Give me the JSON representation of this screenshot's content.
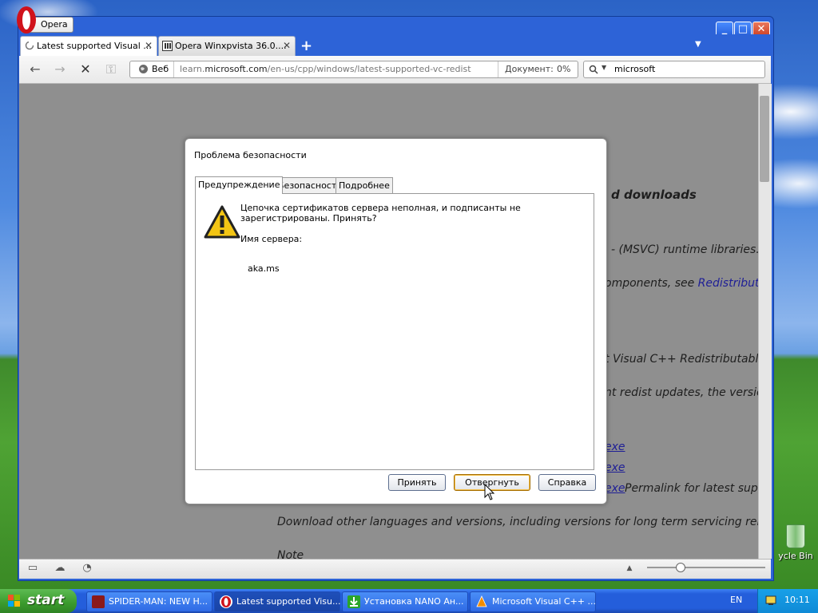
{
  "window": {
    "opera_label": "Opera",
    "controls": {
      "minimize": "_",
      "maximize": "□",
      "close": "✕"
    }
  },
  "tabs": [
    {
      "title": "Latest supported Visual ...",
      "close": "✕",
      "icon": "loading-spinner-icon"
    },
    {
      "title": "Opera Winxpvista 36.0....",
      "close": "✕",
      "icon": "page-icon"
    }
  ],
  "tabbar": {
    "new_tab": "+",
    "menu": "▼"
  },
  "toolbar": {
    "back": "←",
    "forward": "→",
    "stop": "✕",
    "key": "⚿",
    "web_badge": "Веб",
    "url_prefix": "learn.",
    "url_domain": "microsoft.com",
    "url_path": "/en-us/cpp/windows/latest-supported-vc-redist",
    "doc_label": "Документ:",
    "doc_percent": "0%",
    "search_value": "microsoft"
  },
  "page": {
    "heading": "d downloads",
    "l1": "- (MSVC) runtime libraries. T",
    "l2a": "omponents, see ",
    "l2b": "Redistributi",
    "l3": "t Visual C++ Redistributable",
    "l4": "nt redist updates, the version",
    "link1": "exe",
    "link2": "exe",
    "link3": "exe",
    "l5": "Permalink for latest sup",
    "l6": "Download other languages and versions, including versions for long term servicing rele",
    "l7": "Note"
  },
  "dialog": {
    "title": "Проблема безопасности",
    "tabs": [
      "Предупреждение",
      "Безопасность",
      "Подробнее"
    ],
    "message": "Цепочка сертификатов сервера неполная, и подписанты не зарегистрированы. Принять?",
    "server_label": "Имя сервера:",
    "server_value": "aka.ms",
    "buttons": {
      "accept": "Принять",
      "reject": "Отвергнуть",
      "help": "Справка"
    }
  },
  "desktop": {
    "recycle_bin": "ycle Bin"
  },
  "taskbar": {
    "start": "start",
    "tasks": [
      {
        "title": "SPIDER-MAN: NEW H...",
        "icon": "spiderman-icon"
      },
      {
        "title": "Latest supported Visu...",
        "icon": "opera-icon"
      },
      {
        "title": "Установка NANO Ан...",
        "icon": "download-icon"
      },
      {
        "title": "Microsoft Visual C++ ...",
        "icon": "vlc-icon"
      }
    ],
    "lang": "EN",
    "clock": "10:11"
  },
  "colors": {
    "accent": "#2d63d7",
    "taskbar": "#245edb",
    "start": "#3a9a2d",
    "link": "#1f1f96"
  }
}
